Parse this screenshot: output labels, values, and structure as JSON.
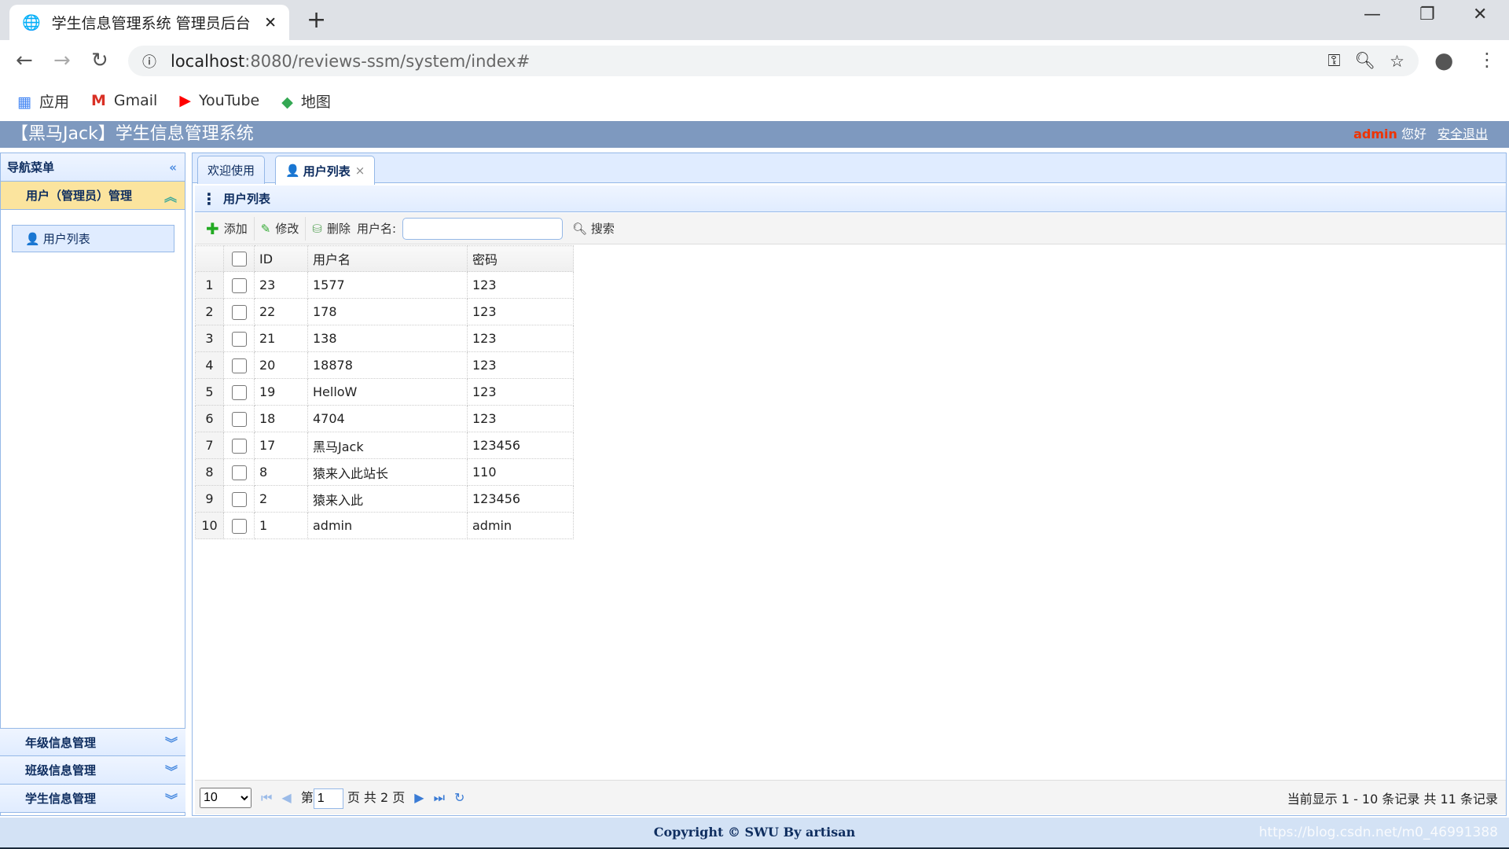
{
  "browser": {
    "tab_title": "学生信息管理系统 管理员后台",
    "url_host": "localhost",
    "url_rest": ":8080/reviews-ssm/system/index#",
    "bookmarks": [
      {
        "icon": "apps-grid-icon",
        "label": "应用"
      },
      {
        "icon": "gmail-icon",
        "label": "Gmail"
      },
      {
        "icon": "youtube-icon",
        "label": "YouTube"
      },
      {
        "icon": "maps-icon",
        "label": "地图"
      }
    ]
  },
  "header": {
    "title": "【黑马Jack】学生信息管理系统",
    "user": "admin",
    "greeting": "您好",
    "logout": "安全退出"
  },
  "sidebar": {
    "title": "导航菜单",
    "open_section": "用户（管理员）管理",
    "items": [
      {
        "label": "用户列表"
      }
    ],
    "sections": [
      {
        "label": "年级信息管理"
      },
      {
        "label": "班级信息管理"
      },
      {
        "label": "学生信息管理"
      }
    ]
  },
  "tabs": [
    {
      "label": "欢迎使用"
    },
    {
      "label": "用户列表"
    }
  ],
  "panel": {
    "title": "用户列表"
  },
  "toolbar": {
    "add": "添加",
    "edit": "修改",
    "delete": "删除",
    "username_label": "用户名:",
    "username_value": "",
    "search": "搜索"
  },
  "grid": {
    "columns": [
      "ID",
      "用户名",
      "密码"
    ],
    "rows": [
      [
        "1",
        "23",
        "1577",
        "123"
      ],
      [
        "2",
        "22",
        "178",
        "123"
      ],
      [
        "3",
        "21",
        "138",
        "123"
      ],
      [
        "4",
        "20",
        "18878",
        "123"
      ],
      [
        "5",
        "19",
        "HelloW",
        "123"
      ],
      [
        "6",
        "18",
        "4704",
        "123"
      ],
      [
        "7",
        "17",
        "黑马Jack",
        "123456"
      ],
      [
        "8",
        "8",
        "猿来入此站长",
        "110"
      ],
      [
        "9",
        "2",
        "猿来入此",
        "123456"
      ],
      [
        "10",
        "1",
        "admin",
        "admin"
      ]
    ]
  },
  "pager": {
    "page_size": "10",
    "page_prefix": "第",
    "page": "1",
    "page_suffix": "页 共 2 页",
    "info": "当前显示 1 - 10 条记录 共 11 条记录"
  },
  "footer": {
    "text": "Copyright © SWU By artisan",
    "watermark": "https://blog.csdn.net/m0_46991388"
  },
  "colors": {
    "header": "#7e99bf",
    "accent_open": "#fbe49e",
    "border": "#95b8e7",
    "admin": "#ee3300"
  }
}
